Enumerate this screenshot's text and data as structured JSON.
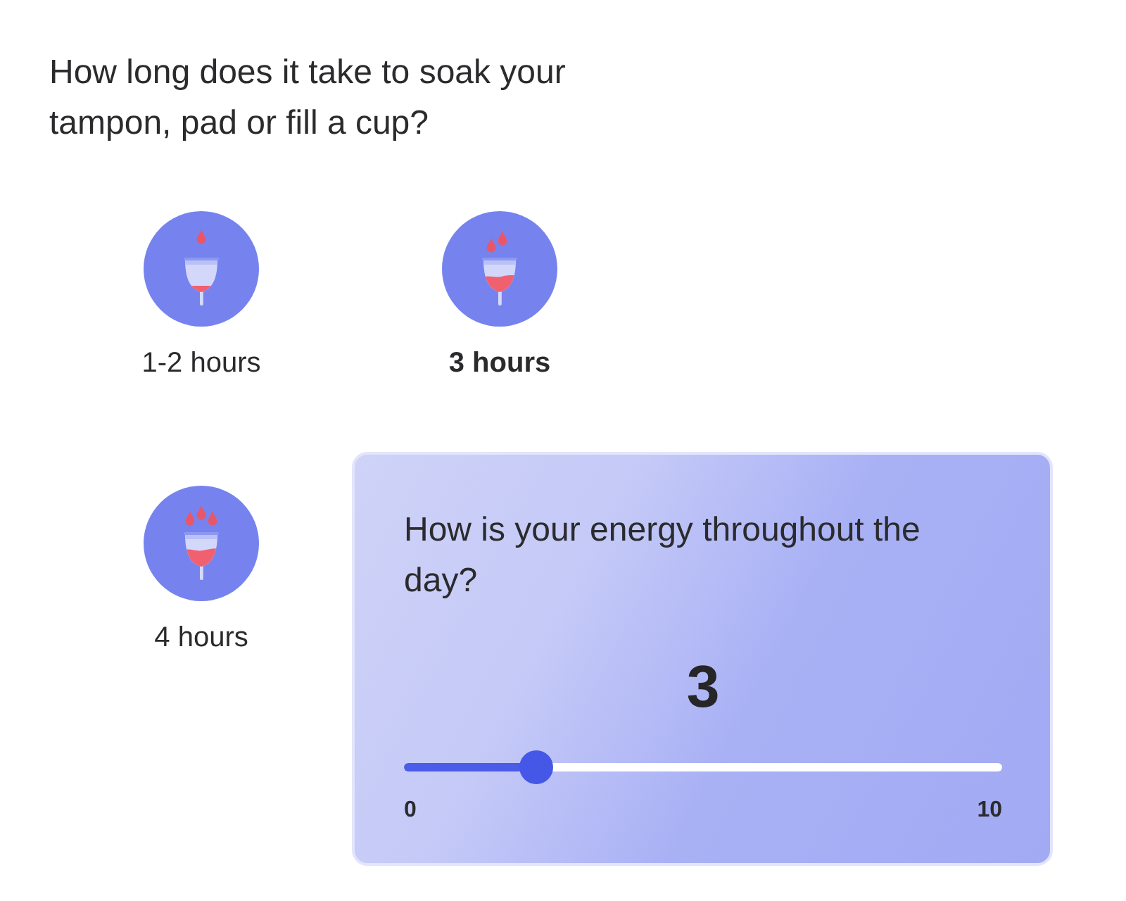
{
  "question": {
    "text": "How long does it take to soak your tampon, pad or fill a cup?"
  },
  "options": [
    {
      "label": "1-2 hours",
      "kind": "light",
      "selected": false
    },
    {
      "label": "3 hours",
      "kind": "medium",
      "selected": true
    },
    {
      "label": "4 hours",
      "kind": "heavy",
      "selected": false
    }
  ],
  "energy_card": {
    "question": "How is your energy throughout the day?",
    "value": "3",
    "slider": {
      "level": 0.22,
      "min_label": "0",
      "max_label": "10"
    }
  }
}
